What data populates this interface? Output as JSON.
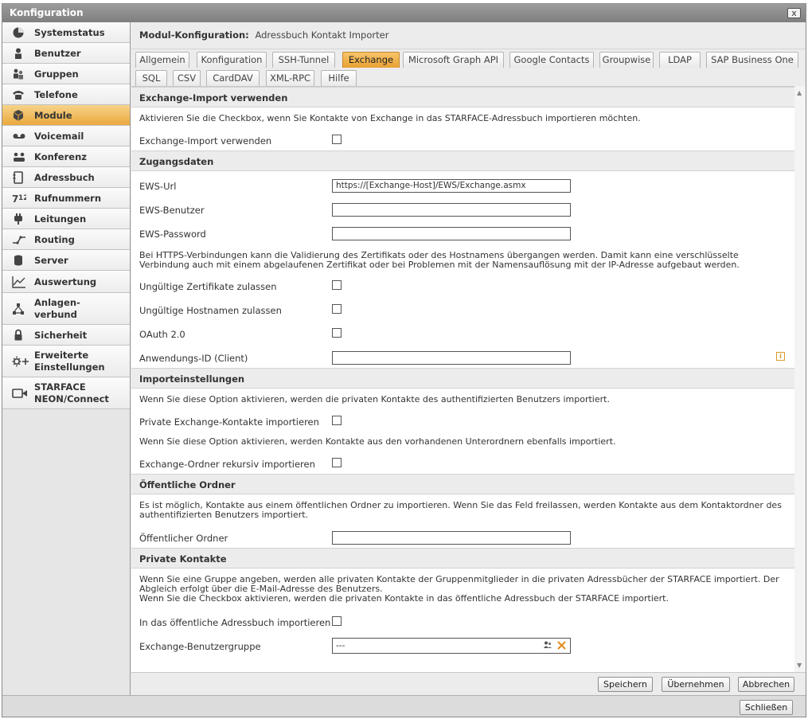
{
  "window": {
    "title": "Konfiguration",
    "close_symbol": "x"
  },
  "sidebar": {
    "items": [
      {
        "label": "Systemstatus",
        "icon": "pie-chart-icon"
      },
      {
        "label": "Benutzer",
        "icon": "user-icon"
      },
      {
        "label": "Gruppen",
        "icon": "group-icon"
      },
      {
        "label": "Telefone",
        "icon": "phone-icon"
      },
      {
        "label": "Module",
        "icon": "module-cube-icon",
        "active": true
      },
      {
        "label": "Voicemail",
        "icon": "voicemail-icon"
      },
      {
        "label": "Konferenz",
        "icon": "conference-icon"
      },
      {
        "label": "Adressbuch",
        "icon": "addressbook-icon"
      },
      {
        "label": "Rufnummern",
        "icon": "numbers-icon"
      },
      {
        "label": "Leitungen",
        "icon": "plug-icon"
      },
      {
        "label": "Routing",
        "icon": "routing-icon"
      },
      {
        "label": "Server",
        "icon": "server-icon"
      },
      {
        "label": "Auswertung",
        "icon": "chart-icon"
      },
      {
        "label": "Anlagen-\nverbund",
        "icon": "network-icon"
      },
      {
        "label": "Sicherheit",
        "icon": "lock-icon"
      },
      {
        "label": "Erweiterte\nEinstellungen",
        "icon": "settings-plus-icon"
      },
      {
        "label": "STARFACE\nNEON/Connect",
        "icon": "video-icon"
      }
    ]
  },
  "module_header": {
    "key": "Modul-Konfiguration:",
    "value": "Adressbuch Kontakt Importer"
  },
  "tabs_row1": [
    "Allgemein",
    "Konfiguration",
    "SSH-Tunnel",
    "Exchange",
    "Microsoft Graph API",
    "Google Contacts",
    "Groupwise",
    "LDAP",
    "SAP Business One"
  ],
  "tabs_row2": [
    "SQL",
    "CSV",
    "CardDAV",
    "XML-RPC",
    "Hilfe"
  ],
  "active_tab": "Exchange",
  "sections": {
    "exchange_import": {
      "title": "Exchange-Import verwenden",
      "desc": "Aktivieren Sie die Checkbox, wenn Sie Kontakte von Exchange in das STARFACE-Adressbuch importieren möchten.",
      "use_label": "Exchange-Import verwenden"
    },
    "access": {
      "title": "Zugangsdaten",
      "ews_url_label": "EWS-Url",
      "ews_url_value": "https://[Exchange-Host]/EWS/Exchange.asmx",
      "ews_user_label": "EWS-Benutzer",
      "ews_password_label": "EWS-Password",
      "https_desc": "Bei HTTPS-Verbindungen kann die Validierung des Zertifikats oder des Hostnamens übergangen werden. Damit kann eine verschlüsselte Verbindung auch mit einem abgelaufenen Zertifikat oder bei Problemen mit der Namensauflösung mit der IP-Adresse aufgebaut werden.",
      "invalid_certs_label": "Ungültige Zertifikate zulassen",
      "invalid_hosts_label": "Ungültige Hostnamen zulassen",
      "oauth_label": "OAuth 2.0",
      "app_id_label": "Anwendungs-ID (Client)"
    },
    "import_settings": {
      "title": "Importeinstellungen",
      "private_desc": "Wenn Sie diese Option aktivieren, werden die privaten Kontakte des authentifizierten Benutzers importiert.",
      "private_label": "Private Exchange-Kontakte importieren",
      "recursive_desc": "Wenn Sie diese Option aktivieren, werden Kontakte aus den vorhandenen Unterordnern ebenfalls importiert.",
      "recursive_label": "Exchange-Ordner rekursiv importieren"
    },
    "public_folders": {
      "title": "Öffentliche Ordner",
      "desc": "Es ist möglich, Kontakte aus einem öffentlichen Ordner zu importieren. Wenn Sie das Feld freilassen, werden Kontakte aus dem Kontaktordner des authentifizierten Benutzers importiert.",
      "folder_label": "Öffentlicher Ordner"
    },
    "private_contacts": {
      "title": "Private Kontakte",
      "desc": "Wenn Sie eine Gruppe angeben, werden alle privaten Kontakte der Gruppenmitglieder in die privaten Adressbücher der STARFACE importiert. Der Abgleich erfolgt über die E-Mail-Adresse des Benutzers.\nWenn Sie die Checkbox aktivieren, werden die privaten Kontakte in das öffentliche Adressbuch der STARFACE importiert.",
      "public_book_label": "In das öffentliche Adressbuch importieren",
      "group_label": "Exchange-Benutzergruppe",
      "group_value": "---"
    }
  },
  "footer": {
    "save": "Speichern",
    "apply": "Übernehmen",
    "cancel": "Abbrechen"
  },
  "bottom": {
    "close": "Schließen"
  }
}
